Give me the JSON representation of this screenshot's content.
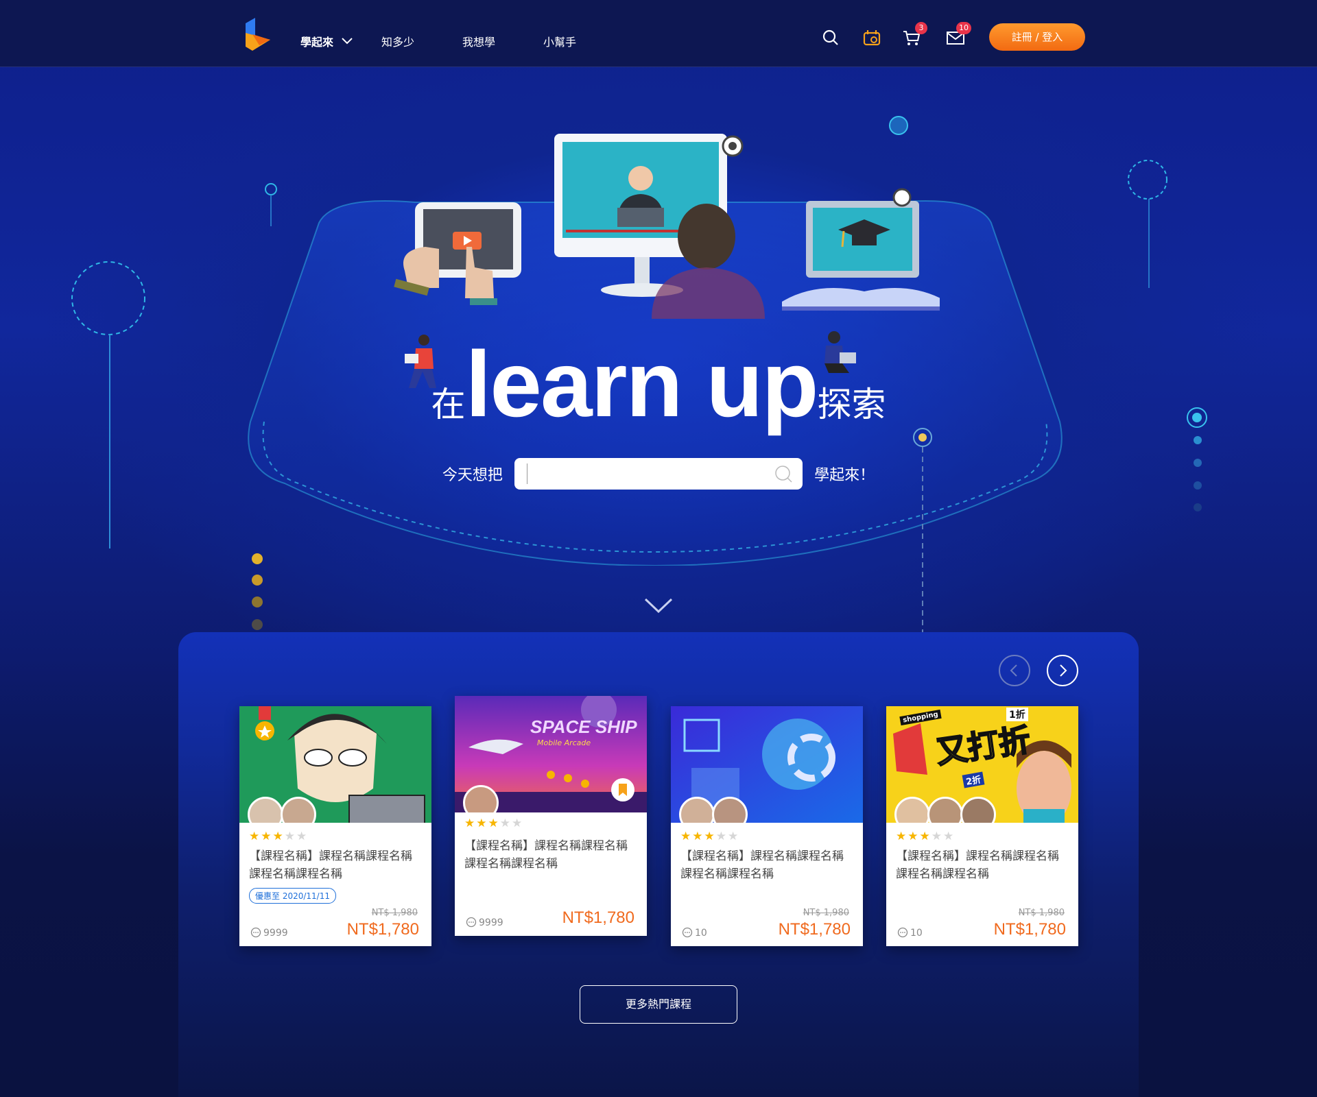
{
  "header": {
    "nav": [
      {
        "label": "學起來"
      },
      {
        "label": "知多少"
      },
      {
        "label": "我想學"
      },
      {
        "label": "小幫手"
      }
    ],
    "cart_count": "3",
    "mail_count": "10",
    "login_label": "註冊 / 登入"
  },
  "hero": {
    "title_pre": "在",
    "title_big": "learn up",
    "title_post": "探索",
    "search_prefix": "今天想把",
    "search_suffix": "學起來！",
    "search_value": ""
  },
  "courses": [
    {
      "title": "【課程名稱】課程名稱課程名稱課程名稱課程名稱",
      "rating": 3,
      "promo": "優惠至 2020/11/11",
      "old_price": "NT$ 1,980",
      "price": "NT$1,780",
      "comments": "9999"
    },
    {
      "title": "【課程名稱】課程名稱課程名稱課程名稱課程名稱",
      "rating": 3,
      "promo": "",
      "old_price": "",
      "price": "NT$1,780",
      "comments": "9999",
      "thumb_text": "SPACE SHIP",
      "thumb_sub": "Mobile Arcade"
    },
    {
      "title": "【課程名稱】課程名稱課程名稱課程名稱課程名稱",
      "rating": 3,
      "promo": "",
      "old_price": "NT$ 1,980",
      "price": "NT$1,780",
      "comments": "10"
    },
    {
      "title": "【課程名稱】課程名稱課程名稱課程名稱課程名稱",
      "rating": 3,
      "promo": "",
      "old_price": "NT$ 1,980",
      "price": "NT$1,780",
      "comments": "10",
      "thumb_text": "又打折",
      "thumb_tag1": "1折",
      "thumb_tag2": "2折",
      "thumb_tag3": "shopping"
    }
  ],
  "more_label": "更多熱門課程",
  "colors": {
    "accent_orange": "#f26a12",
    "price_orange": "#f06a1e",
    "star_yellow": "#f7b500",
    "badge_red": "#e8344a",
    "promo_blue": "#1e6fd9"
  }
}
